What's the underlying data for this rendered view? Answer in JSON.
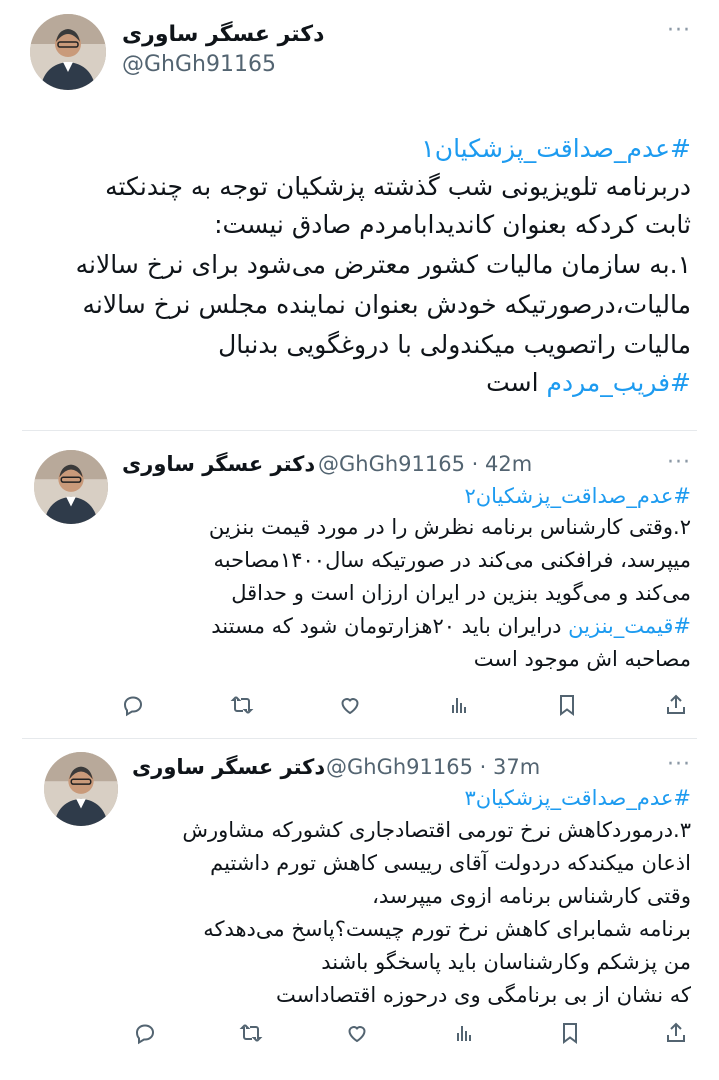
{
  "tweets": [
    {
      "author_name": "دکتر عسگر ساوری",
      "handle": "@GhGh91165",
      "meta": "",
      "more": "···",
      "lines": [
        {
          "tag": "#عدم_صداقت_پزشکیان۱",
          "text": ""
        },
        {
          "tag": "",
          "text": "دربرنامه تلویزیونی شب گذشته پزشکیان توجه به چندنکته"
        },
        {
          "tag": "",
          "text": "ثابت کردکه بعنوان کاندیدابامردم صادق نیست:"
        },
        {
          "tag": "",
          "text": "۱.به سازمان مالیات کشور معترض می‌شود برای نرخ سالانه"
        },
        {
          "tag": "",
          "text": "مالیات،درصورتیکه خودش بعنوان نماینده مجلس نرخ سالانه"
        },
        {
          "tag": "",
          "text": "مالیات راتصویب میکندولی با دروغگویی بدنبال"
        },
        {
          "tag": "#فریب_مردم",
          "text": " است"
        }
      ]
    },
    {
      "author_name": "دکتر عسگر ساوری",
      "handle": "@GhGh91165",
      "meta": "· 42m",
      "more": "···",
      "lines": [
        {
          "tag": "#عدم_صداقت_پزشکیان۲",
          "text": ""
        },
        {
          "tag": "",
          "text": "۲.وقتی کارشناس برنامه نظرش را در مورد قیمت بنزین"
        },
        {
          "tag": "",
          "text": "میپرسد، فرافکنی می‌کند در صورتیکه سال۱۴۰۰مصاحبه"
        },
        {
          "tag": "",
          "text": "می‌کند و می‌گوید بنزین در ایران ارزان است و حداقل"
        },
        {
          "tag": "#قیمت_بنزین",
          "text": " درایران باید ۲۰هزارتومان شود که مستند"
        },
        {
          "tag": "",
          "text": "مصاحبه اش موجود است"
        }
      ]
    },
    {
      "author_name": "دکتر عسگر ساوری",
      "handle": "@GhGh91165",
      "meta": "· 37m",
      "more": "···",
      "lines": [
        {
          "tag": "#عدم_صداقت_پزشکیان۳",
          "text": ""
        },
        {
          "tag": "",
          "text": "۳.درموردکاهش نرخ تورمی اقتصادجاری کشورکه مشاورش"
        },
        {
          "tag": "",
          "text": "اذعان میکندکه دردولت آقای رییسی کاهش تورم داشتیم"
        },
        {
          "tag": "",
          "text": "وقتی کارشناس برنامه ازوی میپرسد،"
        },
        {
          "tag": "",
          "text": "برنامه شمابرای کاهش نرخ تورم چیست؟پاسخ می‌دهدکه"
        },
        {
          "tag": "",
          "text": "من پزشکم وکارشناسان باید پاسخگو باشند"
        },
        {
          "tag": "",
          "text": "که نشان از بی برنامگی وی درحوزه اقتصاداست"
        }
      ]
    }
  ],
  "actions": [
    {
      "icon": "reply-icon"
    },
    {
      "icon": "retweet-icon"
    },
    {
      "icon": "like-icon"
    },
    {
      "icon": "views-icon"
    },
    {
      "icon": "bookmark-icon"
    },
    {
      "icon": "share-icon"
    }
  ],
  "colors": {
    "hashtag": "#1d9bf0",
    "secondary": "#536471",
    "text": "#0f1419",
    "divider": "#e6e9ec"
  }
}
